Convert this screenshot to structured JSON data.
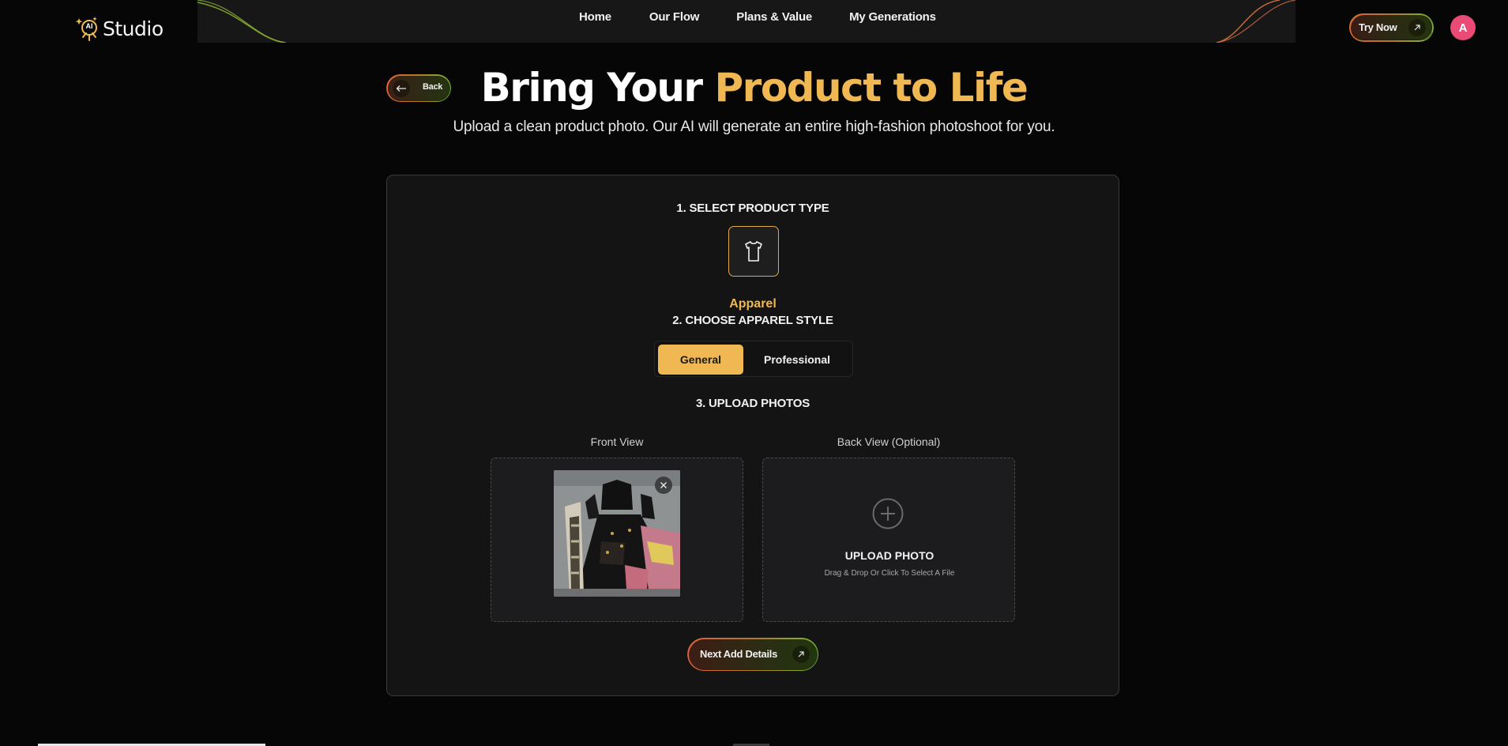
{
  "header": {
    "brand_badge": "AI",
    "brand_name": "Studio",
    "nav": [
      {
        "label": "Home"
      },
      {
        "label": "Our Flow"
      },
      {
        "label": "Plans & Value"
      },
      {
        "label": "My Generations"
      }
    ],
    "try_now_label": "Try Now",
    "avatar_initial": "A"
  },
  "hero": {
    "back_label": "Back",
    "title_white": "Bring Your ",
    "title_gold": "Product to Life",
    "subtitle": "Upload a clean product photo. Our AI will generate an entire high-fashion photoshoot for you."
  },
  "form": {
    "step1_title": "1. SELECT PRODUCT TYPE",
    "product_type": {
      "label": "Apparel",
      "icon": "tshirt-icon",
      "selected": true
    },
    "step2_title": "2. CHOOSE APPAREL STYLE",
    "styles": [
      {
        "label": "General",
        "selected": true
      },
      {
        "label": "Professional",
        "selected": false
      }
    ],
    "step3_title": "3. UPLOAD PHOTOS",
    "front_view": {
      "label": "Front View",
      "has_image": true
    },
    "back_view": {
      "label": "Back View (Optional)",
      "upload_title": "UPLOAD PHOTO",
      "upload_hint": "Drag & Drop Or Click To Select A File"
    },
    "next_label": "Next Add Details"
  },
  "colors": {
    "accent_gold": "#f0b853",
    "avatar_pink": "#e94a76",
    "gradient_start": "#e0603a",
    "gradient_end": "#79b82f",
    "background": "#060606"
  }
}
